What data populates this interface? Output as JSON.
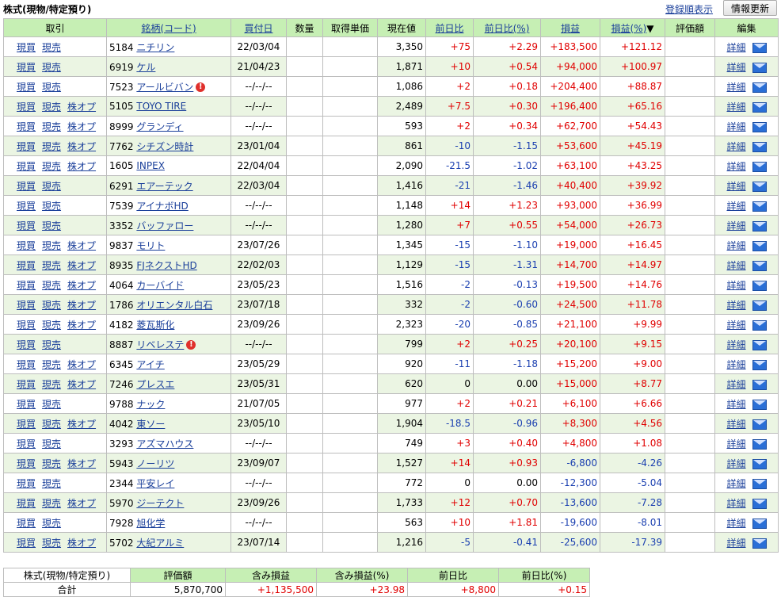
{
  "header": {
    "section_title": "株式(現物/特定預り)",
    "order_link": "登録順表示",
    "refresh_button": "情報更新"
  },
  "columns": {
    "trade": "取引",
    "name": "銘柄(コード)",
    "bought": "買付日",
    "qty": "数量",
    "cost": "取得単価",
    "price": "現在値",
    "change": "前日比",
    "change_pct": "前日比(%)",
    "pl": "損益",
    "pl_pct": "損益(%)",
    "sort_mark": "▼",
    "value": "評価額",
    "edit": "編集"
  },
  "actions": {
    "buy": "現買",
    "sell": "現売",
    "option": "株オプ",
    "detail": "詳細"
  },
  "colors": {
    "header_bg": "#c6efb4",
    "row_alt": "#ebf5e3",
    "positive": "#e00000",
    "negative": "#1a3fb0"
  },
  "rows": [
    {
      "code": "5184",
      "name": "ニチリン",
      "opt": false,
      "warn": false,
      "date": "22/03/04",
      "price": "3,350",
      "chg": "+75",
      "chgp": "+2.29",
      "pl": "+183,500",
      "plp": "+121.12"
    },
    {
      "code": "6919",
      "name": "ケル",
      "opt": false,
      "warn": false,
      "date": "21/04/23",
      "price": "1,871",
      "chg": "+10",
      "chgp": "+0.54",
      "pl": "+94,000",
      "plp": "+100.97"
    },
    {
      "code": "7523",
      "name": "アールビバン",
      "opt": false,
      "warn": true,
      "date": "--/--/--",
      "price": "1,086",
      "chg": "+2",
      "chgp": "+0.18",
      "pl": "+204,400",
      "plp": "+88.87"
    },
    {
      "code": "5105",
      "name": "TOYO TIRE",
      "opt": true,
      "warn": false,
      "date": "--/--/--",
      "price": "2,489",
      "chg": "+7.5",
      "chgp": "+0.30",
      "pl": "+196,400",
      "plp": "+65.16"
    },
    {
      "code": "8999",
      "name": "グランディ",
      "opt": true,
      "warn": false,
      "date": "--/--/--",
      "price": "593",
      "chg": "+2",
      "chgp": "+0.34",
      "pl": "+62,700",
      "plp": "+54.43"
    },
    {
      "code": "7762",
      "name": "シチズン時計",
      "opt": true,
      "warn": false,
      "date": "23/01/04",
      "price": "861",
      "chg": "-10",
      "chgp": "-1.15",
      "pl": "+53,600",
      "plp": "+45.19"
    },
    {
      "code": "1605",
      "name": "INPEX",
      "opt": true,
      "warn": false,
      "date": "22/04/04",
      "price": "2,090",
      "chg": "-21.5",
      "chgp": "-1.02",
      "pl": "+63,100",
      "plp": "+43.25"
    },
    {
      "code": "6291",
      "name": "エアーテック",
      "opt": false,
      "warn": false,
      "date": "22/03/04",
      "price": "1,416",
      "chg": "-21",
      "chgp": "-1.46",
      "pl": "+40,400",
      "plp": "+39.92"
    },
    {
      "code": "7539",
      "name": "アイナボHD",
      "opt": false,
      "warn": false,
      "date": "--/--/--",
      "price": "1,148",
      "chg": "+14",
      "chgp": "+1.23",
      "pl": "+93,000",
      "plp": "+36.99"
    },
    {
      "code": "3352",
      "name": "バッファロー",
      "opt": false,
      "warn": false,
      "date": "--/--/--",
      "price": "1,280",
      "chg": "+7",
      "chgp": "+0.55",
      "pl": "+54,000",
      "plp": "+26.73"
    },
    {
      "code": "9837",
      "name": "モリト",
      "opt": true,
      "warn": false,
      "date": "23/07/26",
      "price": "1,345",
      "chg": "-15",
      "chgp": "-1.10",
      "pl": "+19,000",
      "plp": "+16.45"
    },
    {
      "code": "8935",
      "name": "FJネクストHD",
      "opt": true,
      "warn": false,
      "date": "22/02/03",
      "price": "1,129",
      "chg": "-15",
      "chgp": "-1.31",
      "pl": "+14,700",
      "plp": "+14.97"
    },
    {
      "code": "4064",
      "name": "カーバイド",
      "opt": true,
      "warn": false,
      "date": "23/05/23",
      "price": "1,516",
      "chg": "-2",
      "chgp": "-0.13",
      "pl": "+19,500",
      "plp": "+14.76"
    },
    {
      "code": "1786",
      "name": "オリエンタル白石",
      "opt": true,
      "warn": false,
      "date": "23/07/18",
      "price": "332",
      "chg": "-2",
      "chgp": "-0.60",
      "pl": "+24,500",
      "plp": "+11.78"
    },
    {
      "code": "4182",
      "name": "菱瓦斯化",
      "opt": true,
      "warn": false,
      "date": "23/09/26",
      "price": "2,323",
      "chg": "-20",
      "chgp": "-0.85",
      "pl": "+21,100",
      "plp": "+9.99"
    },
    {
      "code": "8887",
      "name": "リベレステ",
      "opt": false,
      "warn": true,
      "date": "--/--/--",
      "price": "799",
      "chg": "+2",
      "chgp": "+0.25",
      "pl": "+20,100",
      "plp": "+9.15"
    },
    {
      "code": "6345",
      "name": "アイチ",
      "opt": true,
      "warn": false,
      "date": "23/05/29",
      "price": "920",
      "chg": "-11",
      "chgp": "-1.18",
      "pl": "+15,200",
      "plp": "+9.00"
    },
    {
      "code": "7246",
      "name": "プレスエ",
      "opt": true,
      "warn": false,
      "date": "23/05/31",
      "price": "620",
      "chg": "0",
      "chgp": "0.00",
      "pl": "+15,000",
      "plp": "+8.77"
    },
    {
      "code": "9788",
      "name": "ナック",
      "opt": false,
      "warn": false,
      "date": "21/07/05",
      "price": "977",
      "chg": "+2",
      "chgp": "+0.21",
      "pl": "+6,100",
      "plp": "+6.66"
    },
    {
      "code": "4042",
      "name": "東ソー",
      "opt": true,
      "warn": false,
      "date": "23/05/10",
      "price": "1,904",
      "chg": "-18.5",
      "chgp": "-0.96",
      "pl": "+8,300",
      "plp": "+4.56"
    },
    {
      "code": "3293",
      "name": "アズマハウス",
      "opt": false,
      "warn": false,
      "date": "--/--/--",
      "price": "749",
      "chg": "+3",
      "chgp": "+0.40",
      "pl": "+4,800",
      "plp": "+1.08"
    },
    {
      "code": "5943",
      "name": "ノーリツ",
      "opt": true,
      "warn": false,
      "date": "23/09/07",
      "price": "1,527",
      "chg": "+14",
      "chgp": "+0.93",
      "pl": "-6,800",
      "plp": "-4.26"
    },
    {
      "code": "2344",
      "name": "平安レイ",
      "opt": false,
      "warn": false,
      "date": "--/--/--",
      "price": "772",
      "chg": "0",
      "chgp": "0.00",
      "pl": "-12,300",
      "plp": "-5.04"
    },
    {
      "code": "5970",
      "name": "ジーテクト",
      "opt": true,
      "warn": false,
      "date": "23/09/26",
      "price": "1,733",
      "chg": "+12",
      "chgp": "+0.70",
      "pl": "-13,600",
      "plp": "-7.28"
    },
    {
      "code": "7928",
      "name": "旭化学",
      "opt": false,
      "warn": false,
      "date": "--/--/--",
      "price": "563",
      "chg": "+10",
      "chgp": "+1.81",
      "pl": "-19,600",
      "plp": "-8.01"
    },
    {
      "code": "5702",
      "name": "大紀アルミ",
      "opt": true,
      "warn": false,
      "date": "23/07/14",
      "price": "1,216",
      "chg": "-5",
      "chgp": "-0.41",
      "pl": "-25,600",
      "plp": "-17.39"
    }
  ],
  "summary": {
    "label_line1": "株式(現物/特定預り)",
    "label_line2": "合計",
    "headers": [
      "評価額",
      "含み損益",
      "含み損益(%)",
      "前日比",
      "前日比(%)"
    ],
    "values": [
      "5,870,700",
      "+1,135,500",
      "+23.98",
      "+8,800",
      "+0.15"
    ]
  }
}
